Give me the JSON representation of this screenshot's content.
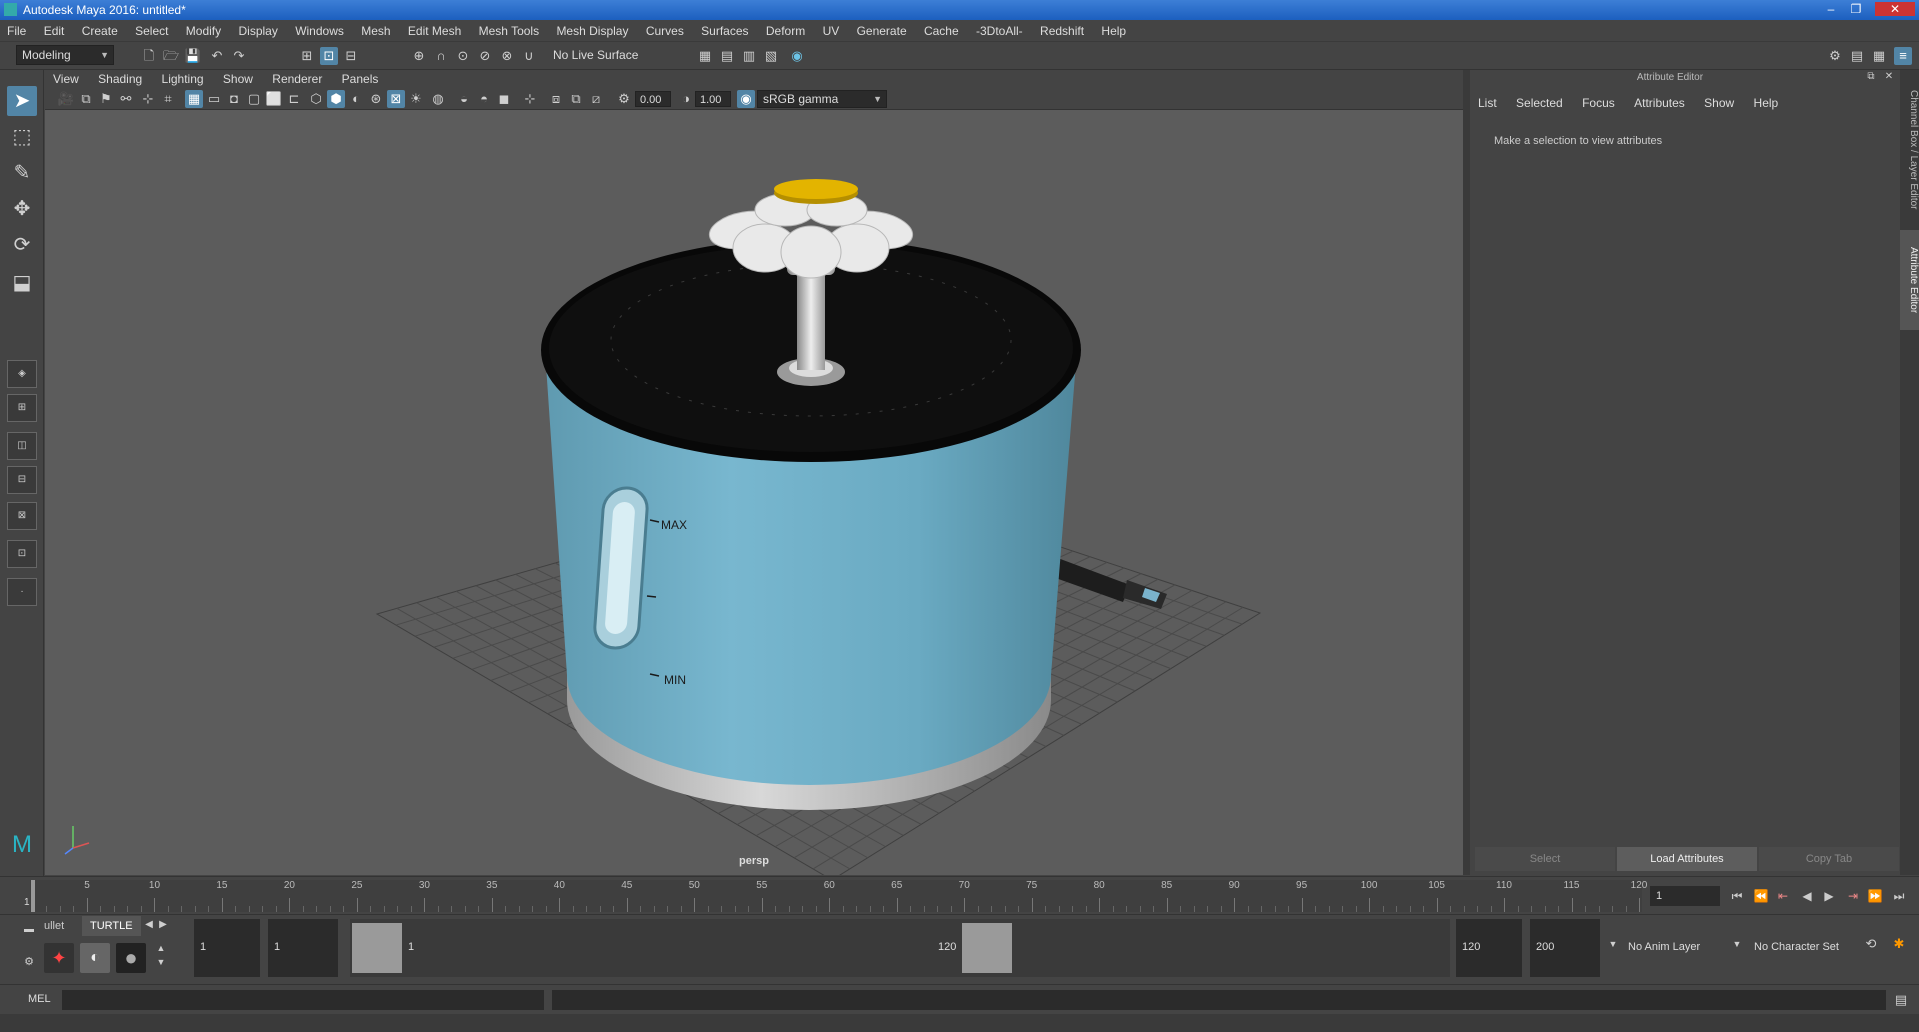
{
  "window": {
    "title": "Autodesk Maya 2016: untitled*"
  },
  "menubar": [
    "File",
    "Edit",
    "Create",
    "Select",
    "Modify",
    "Display",
    "Windows",
    "Mesh",
    "Edit Mesh",
    "Mesh Tools",
    "Mesh Display",
    "Curves",
    "Surfaces",
    "Deform",
    "UV",
    "Generate",
    "Cache",
    "-3DtoAll-",
    "Redshift",
    "Help"
  ],
  "shelf": {
    "mode": "Modeling",
    "live_surface": "No Live Surface"
  },
  "viewport": {
    "menus": [
      "View",
      "Shading",
      "Lighting",
      "Show",
      "Renderer",
      "Panels"
    ],
    "exposure": "0.00",
    "gamma": "1.00",
    "color_space": "sRGB gamma",
    "camera": "persp",
    "model_labels": {
      "max": "MAX",
      "min": "MIN"
    },
    "colors": {
      "background": "#5c5c5c",
      "body": "#6fb0c8",
      "lid": "#0d0d0d",
      "flower_center": "#e0b300",
      "petals": "#e9e9e9",
      "base": "#bdbdbd"
    }
  },
  "attribute_editor": {
    "title": "Attribute Editor",
    "menus": [
      "List",
      "Selected",
      "Focus",
      "Attributes",
      "Show",
      "Help"
    ],
    "message": "Make a selection to view attributes",
    "buttons": {
      "select": "Select",
      "load": "Load Attributes",
      "copy": "Copy Tab"
    }
  },
  "side_tabs": [
    "Channel Box / Layer Editor",
    "Attribute Editor"
  ],
  "timeline": {
    "ticks": [
      "5",
      "10",
      "15",
      "20",
      "25",
      "30",
      "35",
      "40",
      "45",
      "50",
      "55",
      "60",
      "65",
      "70",
      "75",
      "80",
      "85",
      "90",
      "95",
      "100",
      "105",
      "110",
      "115",
      "120"
    ],
    "start": "1",
    "current_frame": "1"
  },
  "range": {
    "shelf_tabs": [
      "ullet",
      "TURTLE"
    ],
    "start": "1",
    "anim_start": "1",
    "range_start": "1",
    "range_end": "120",
    "end": "120",
    "anim_end": "200",
    "anim_layer": "No Anim Layer",
    "character_set": "No Character Set"
  },
  "command_line": {
    "language": "MEL"
  }
}
